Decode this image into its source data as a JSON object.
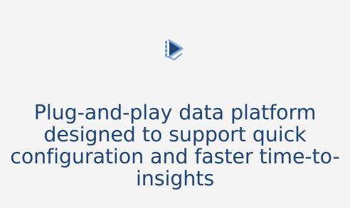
{
  "feature_card": {
    "icon": "play-data-icon",
    "headline": "Plug-and-play data platform designed to support quick configuration and faster time-to-insights",
    "colors": {
      "background": "#f4f4f4",
      "text": "#1e4576",
      "icon_primary": "#1e4576",
      "icon_accent": "#7ea7d8"
    }
  }
}
